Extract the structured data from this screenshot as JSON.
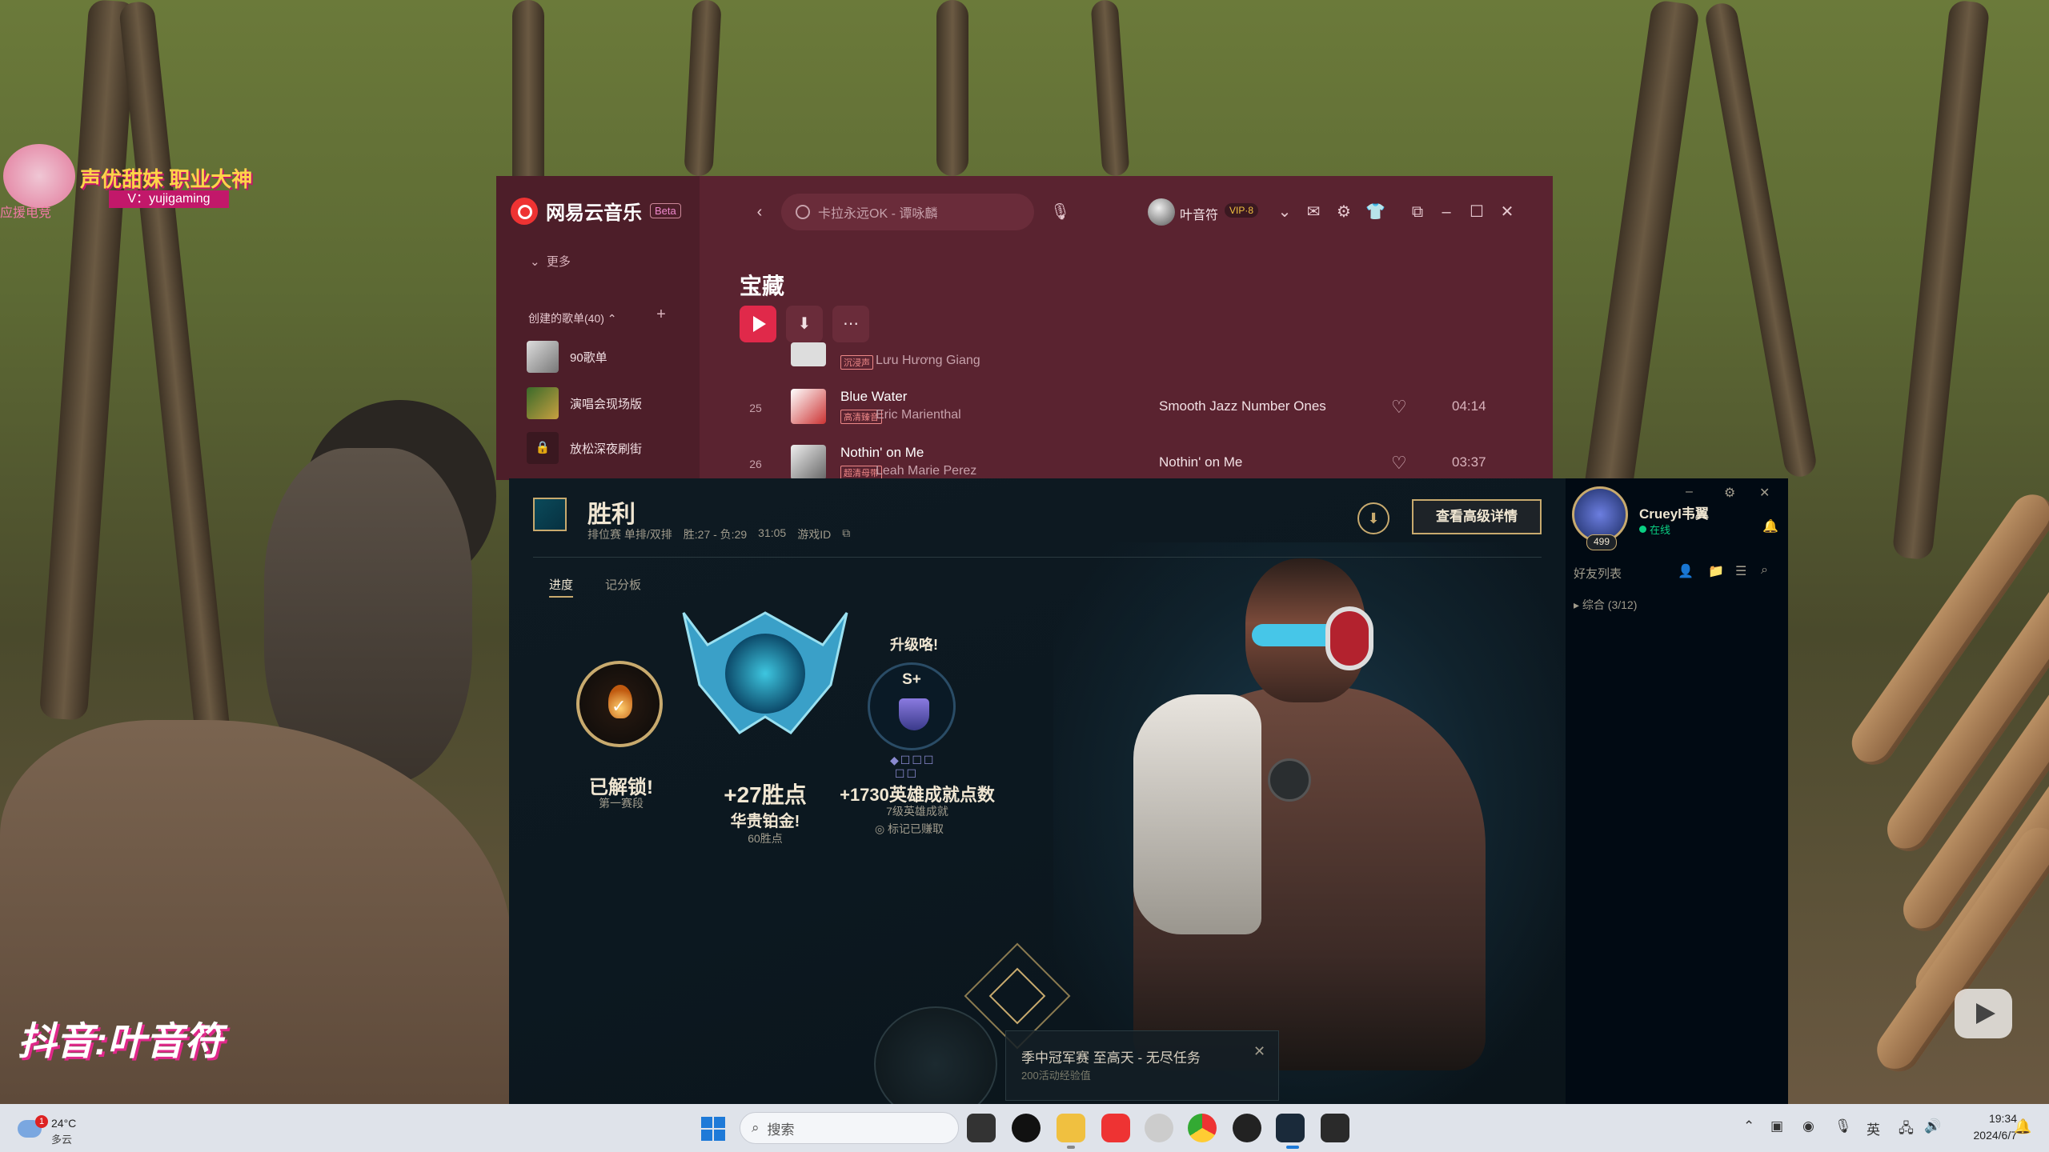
{
  "overlay": {
    "badge_title": "声优甜妹 职业大神",
    "badge_sub": "V：yujigaming",
    "badge_brand": "应援电竞",
    "douyin": "抖音:叶音符"
  },
  "music": {
    "app_name": "网易云音乐",
    "beta": "Beta",
    "search_placeholder": "卡拉永远OK - 谭咏麟",
    "user_name": "叶音符",
    "vip": "VIP·8",
    "more": "更多",
    "created_playlists": "创建的歌单(40)",
    "playlists": [
      {
        "name": "90歌单"
      },
      {
        "name": "演唱会现场版"
      },
      {
        "name": "放松深夜刷街"
      }
    ],
    "page_title": "宝藏",
    "songs": [
      {
        "num": "",
        "title": "",
        "tag": "沉浸声",
        "artist": "Lưu Hương Giang",
        "album": "",
        "duration": ""
      },
      {
        "num": "25",
        "title": "Blue Water",
        "tag": "高清臻音",
        "artist": "Eric Marienthal",
        "album": "Smooth Jazz Number Ones",
        "duration": "04:14"
      },
      {
        "num": "26",
        "title": "Nothin' on Me",
        "tag": "超清母带",
        "artist": "Leah Marie Perez",
        "album": "Nothin' on Me",
        "duration": "03:37"
      }
    ]
  },
  "lol": {
    "title": "胜利",
    "meta": [
      "排位赛 单排/双排",
      "胜:27 - 负:29",
      "31:05",
      "游戏ID"
    ],
    "advanced_button": "查看高级详情",
    "tabs": [
      "进度",
      "记分板"
    ],
    "unlock_title": "已解锁!",
    "unlock_sub": "第一赛段",
    "lp_gain": "+27胜点",
    "rank_name": "华贵铂金!",
    "rank_lp": "60胜点",
    "upgrade": "升级咯!",
    "grade": "S+",
    "mastery_points": "+1730英雄成就点数",
    "mastery_level": "7级英雄成就",
    "mark_earned": "标记已赚取",
    "mission_title": "季中冠军赛 至高天 - 无尽任务",
    "mission_sub": "200活动经验值",
    "friends": {
      "name": "Crueyl韦翼",
      "level": "499",
      "status": "在线",
      "list_title": "好友列表",
      "group": "综合 (3/12)"
    }
  },
  "taskbar": {
    "temp": "24°C",
    "condition": "多云",
    "weather_badge": "1",
    "search": "搜索",
    "lang": "英",
    "time": "19:34",
    "date": "2024/6/7"
  }
}
